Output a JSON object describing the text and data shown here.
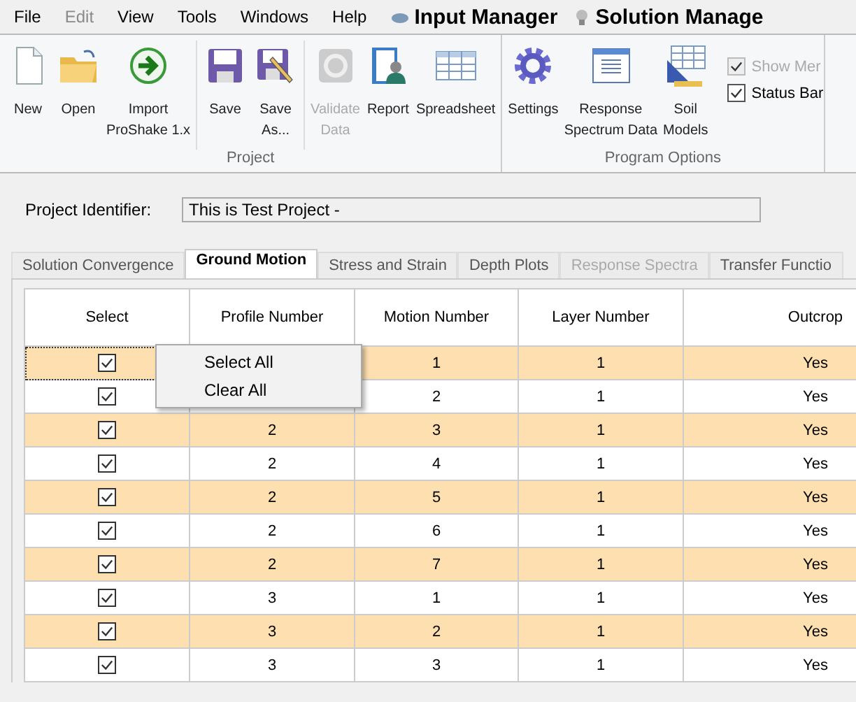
{
  "menu_bar": {
    "items": [
      {
        "label": "File",
        "disabled": false
      },
      {
        "label": "Edit",
        "disabled": true
      },
      {
        "label": "View",
        "disabled": false
      },
      {
        "label": "Tools",
        "disabled": false
      },
      {
        "label": "Windows",
        "disabled": false
      },
      {
        "label": "Help",
        "disabled": false
      }
    ],
    "managers": [
      {
        "label": "Input Manager"
      },
      {
        "label": "Solution Manage"
      }
    ]
  },
  "ribbon": {
    "groups": [
      {
        "label": "Project",
        "sections": [
          [
            {
              "label": "New",
              "disabled": false
            },
            {
              "label": "Open",
              "disabled": false
            },
            {
              "label": "Import\nProShake 1.x",
              "disabled": false
            }
          ],
          [
            {
              "label": "Save",
              "disabled": false
            },
            {
              "label": "Save\nAs...",
              "disabled": false
            }
          ],
          [
            {
              "label": "Validate\nData",
              "disabled": true
            },
            {
              "label": "Report",
              "disabled": false
            },
            {
              "label": "Spreadsheet",
              "disabled": false
            }
          ]
        ]
      },
      {
        "label": "Program Options",
        "sections": [
          [
            {
              "label": "Settings",
              "disabled": false
            },
            {
              "label": "Response\nSpectrum Data",
              "disabled": false
            },
            {
              "label": "Soil\nModels",
              "disabled": false
            }
          ]
        ],
        "checkboxes": [
          {
            "label": "Show Mer",
            "checked": true,
            "disabled": true
          },
          {
            "label": "Status Bar",
            "checked": true,
            "disabled": false
          }
        ]
      }
    ]
  },
  "project_identifier": {
    "label": "Project Identifier:",
    "value": "This is Test Project -"
  },
  "tabs": [
    {
      "label": "Solution Convergence",
      "selected": false,
      "disabled": false
    },
    {
      "label": "Ground Motion",
      "selected": true,
      "disabled": false
    },
    {
      "label": "Stress and Strain",
      "selected": false,
      "disabled": false
    },
    {
      "label": "Depth Plots",
      "selected": false,
      "disabled": false
    },
    {
      "label": "Response Spectra",
      "selected": false,
      "disabled": true
    },
    {
      "label": "Transfer Functio",
      "selected": false,
      "disabled": false
    }
  ],
  "table": {
    "columns": [
      "Select",
      "Profile Number",
      "Motion Number",
      "Layer Number",
      "Outcrop"
    ],
    "rows": [
      {
        "checked": true,
        "focused": true,
        "profile": "",
        "motion": "1",
        "layer": "1",
        "outcrop": "Yes"
      },
      {
        "checked": true,
        "focused": false,
        "profile": "",
        "motion": "2",
        "layer": "1",
        "outcrop": "Yes"
      },
      {
        "checked": true,
        "focused": false,
        "profile": "2",
        "motion": "3",
        "layer": "1",
        "outcrop": "Yes"
      },
      {
        "checked": true,
        "focused": false,
        "profile": "2",
        "motion": "4",
        "layer": "1",
        "outcrop": "Yes"
      },
      {
        "checked": true,
        "focused": false,
        "profile": "2",
        "motion": "5",
        "layer": "1",
        "outcrop": "Yes"
      },
      {
        "checked": true,
        "focused": false,
        "profile": "2",
        "motion": "6",
        "layer": "1",
        "outcrop": "Yes"
      },
      {
        "checked": true,
        "focused": false,
        "profile": "2",
        "motion": "7",
        "layer": "1",
        "outcrop": "Yes"
      },
      {
        "checked": true,
        "focused": false,
        "profile": "3",
        "motion": "1",
        "layer": "1",
        "outcrop": "Yes"
      },
      {
        "checked": true,
        "focused": false,
        "profile": "3",
        "motion": "2",
        "layer": "1",
        "outcrop": "Yes"
      },
      {
        "checked": true,
        "focused": false,
        "profile": "3",
        "motion": "3",
        "layer": "1",
        "outcrop": "Yes"
      }
    ]
  },
  "context_menu": {
    "items": [
      {
        "label": "Select All"
      },
      {
        "label": "Clear All"
      }
    ]
  }
}
